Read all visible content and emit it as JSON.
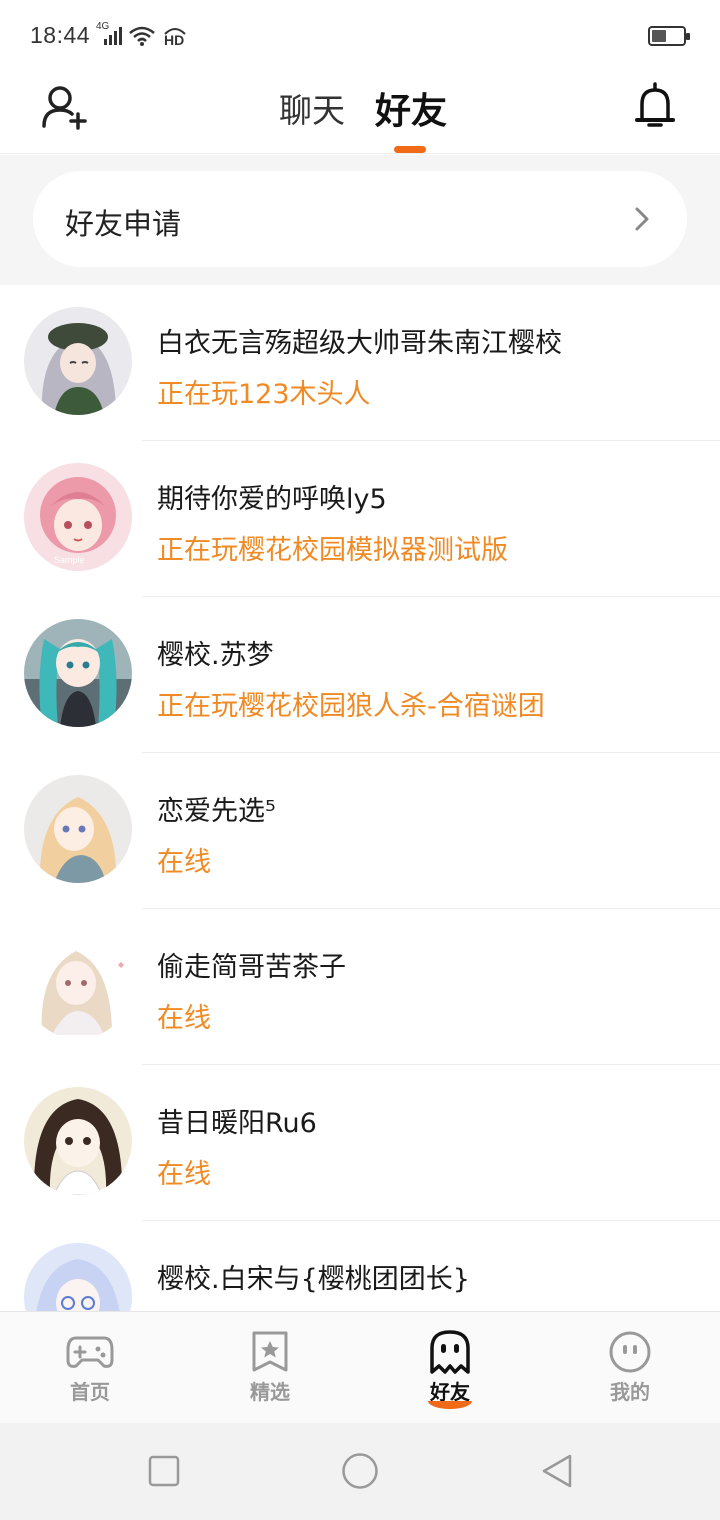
{
  "status_bar": {
    "time": "18:44",
    "network_label": "4G",
    "hd_label": "HD",
    "battery_level": 0.45
  },
  "header": {
    "tabs": [
      {
        "label": "聊天",
        "active": false
      },
      {
        "label": "好友",
        "active": true
      }
    ],
    "accent_color": "#f06a17"
  },
  "friend_requests": {
    "label": "好友申请"
  },
  "friends": [
    {
      "name": "白衣无言殇超级大帅哥朱南江樱校",
      "status": "正在玩123木头人",
      "avatar_icon": "anime-girl-grey-hair-avatar"
    },
    {
      "name": "期待你爱的呼唤ly5",
      "status": "正在玩樱花校园模拟器测试版",
      "avatar_icon": "anime-girl-pink-hair-avatar",
      "avatar_watermark": "Sample"
    },
    {
      "name": "樱校.苏梦",
      "status": "正在玩樱花校园狼人杀-合宿谜团",
      "avatar_icon": "anime-girl-teal-twintails-avatar"
    },
    {
      "name": "恋爱先选⁵",
      "status": "在线",
      "avatar_icon": "anime-girl-blonde-avatar"
    },
    {
      "name": "偷走简哥苦茶子",
      "status": "在线",
      "avatar_icon": "anime-girl-light-hair-avatar"
    },
    {
      "name": "昔日暖阳Ru6",
      "status": "在线",
      "avatar_icon": "anime-girl-dark-hair-avatar"
    },
    {
      "name": "樱校.白宋与{樱桃团团长}",
      "status": "",
      "avatar_icon": "anime-girl-white-hair-glasses-avatar"
    }
  ],
  "status_color": "#f08a24",
  "bottom_nav": {
    "items": [
      {
        "label": "首页",
        "icon": "gamepad-icon",
        "active": false
      },
      {
        "label": "精选",
        "icon": "star-badge-icon",
        "active": false
      },
      {
        "label": "好友",
        "icon": "ghost-icon",
        "active": true
      },
      {
        "label": "我的",
        "icon": "smiley-face-icon",
        "active": false
      }
    ]
  },
  "system_nav": {
    "buttons": [
      "recents-square-icon",
      "home-circle-icon",
      "back-triangle-icon"
    ]
  }
}
